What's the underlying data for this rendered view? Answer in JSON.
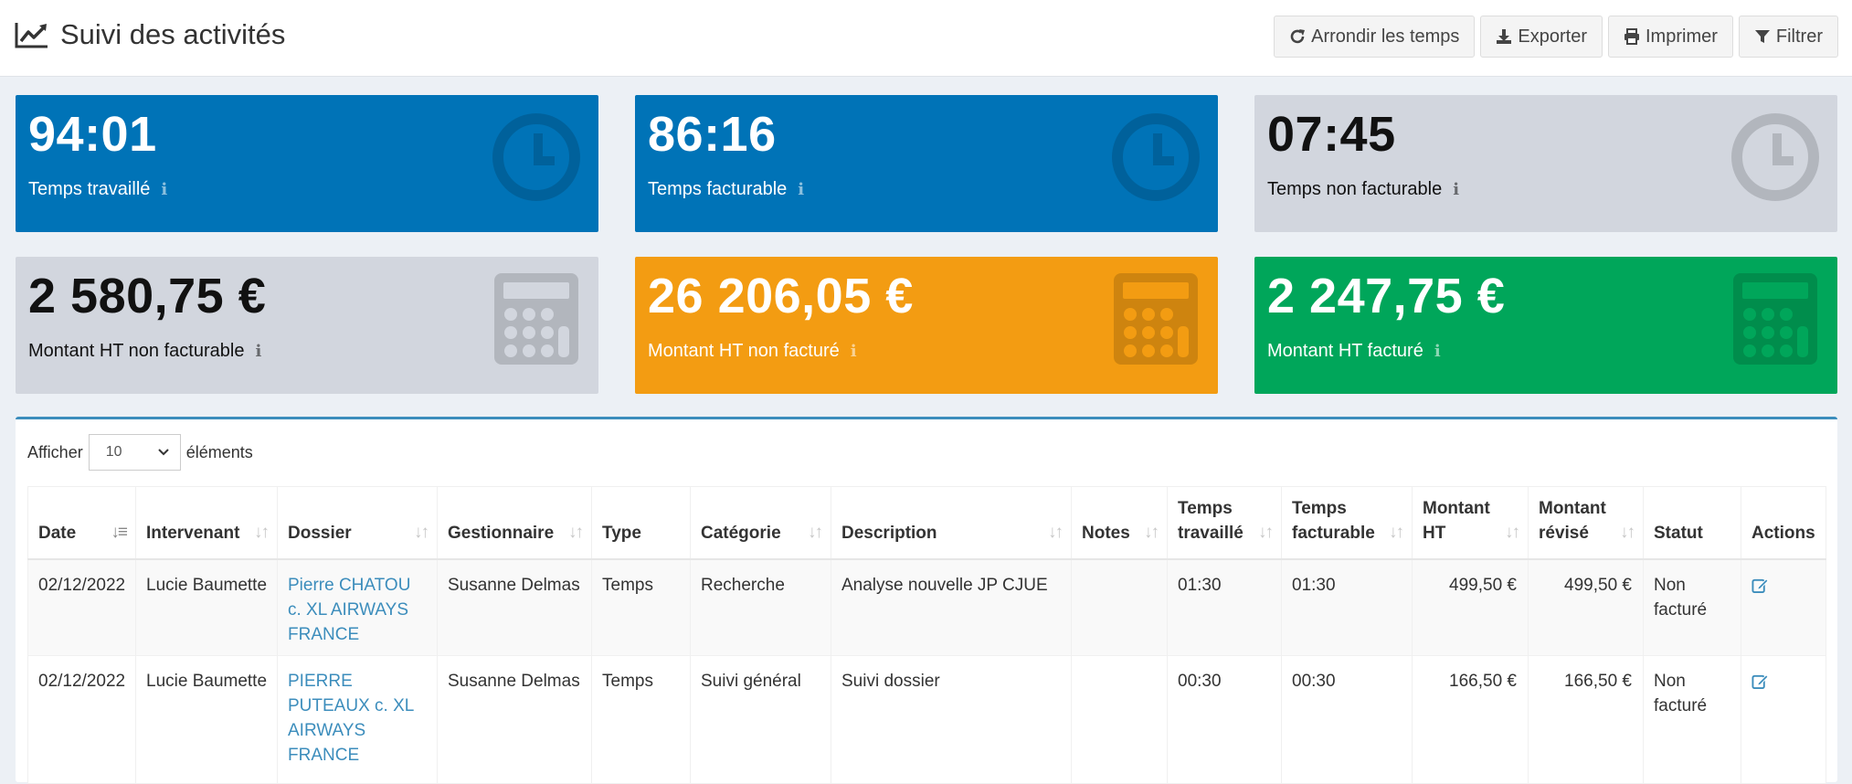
{
  "header": {
    "title": "Suivi des activités",
    "buttons": {
      "round": "Arrondir les temps",
      "export": "Exporter",
      "print": "Imprimer",
      "filter": "Filtrer"
    }
  },
  "stats": [
    {
      "value": "94:01",
      "label": "Temps travaillé",
      "icon": "clock-icon",
      "color": "#0073b7"
    },
    {
      "value": "86:16",
      "label": "Temps facturable",
      "icon": "clock-icon",
      "color": "#0073b7"
    },
    {
      "value": "07:45",
      "label": "Temps non facturable",
      "icon": "clock-icon",
      "color": "#d2d6de"
    },
    {
      "value": "2 580,75 €",
      "label": "Montant HT non facturable",
      "icon": "calculator-icon",
      "color": "#d2d6de"
    },
    {
      "value": "26 206,05 €",
      "label": "Montant HT non facturé",
      "icon": "calculator-icon",
      "color": "#f39c12"
    },
    {
      "value": "2 247,75 €",
      "label": "Montant HT facturé",
      "icon": "calculator-icon",
      "color": "#00a65a"
    }
  ],
  "info_glyph": "i",
  "table": {
    "length_prefix": "Afficher",
    "length_value": "10",
    "length_suffix": "éléments",
    "sort_glyph": "↓↑",
    "columns": [
      "Date",
      "Intervenant",
      "Dossier",
      "Gestionnaire",
      "Type",
      "Catégorie",
      "Description",
      "Notes",
      "Temps travaillé",
      "Temps facturable",
      "Montant HT",
      "Montant révisé",
      "Statut",
      "Actions"
    ],
    "rows": [
      {
        "date": "02/12/2022",
        "intervenant": "Lucie Baumette",
        "dossier": "Pierre CHATOU c. XL AIRWAYS FRANCE",
        "gestionnaire": "Susanne Delmas",
        "type": "Temps",
        "categorie": "Recherche",
        "description": "Analyse nouvelle JP CJUE",
        "notes": "",
        "temps_travaille": "01:30",
        "temps_facturable": "01:30",
        "montant_ht": "499,50 €",
        "montant_revise": "499,50 €",
        "statut": "Non facturé"
      },
      {
        "date": "02/12/2022",
        "intervenant": "Lucie Baumette",
        "dossier": "PIERRE PUTEAUX c. XL AIRWAYS FRANCE",
        "gestionnaire": "Susanne Delmas",
        "type": "Temps",
        "categorie": "Suivi général",
        "description": "Suivi dossier",
        "notes": "",
        "temps_travaille": "00:30",
        "temps_facturable": "00:30",
        "montant_ht": "166,50 €",
        "montant_revise": "166,50 €",
        "statut": "Non facturé"
      }
    ]
  }
}
